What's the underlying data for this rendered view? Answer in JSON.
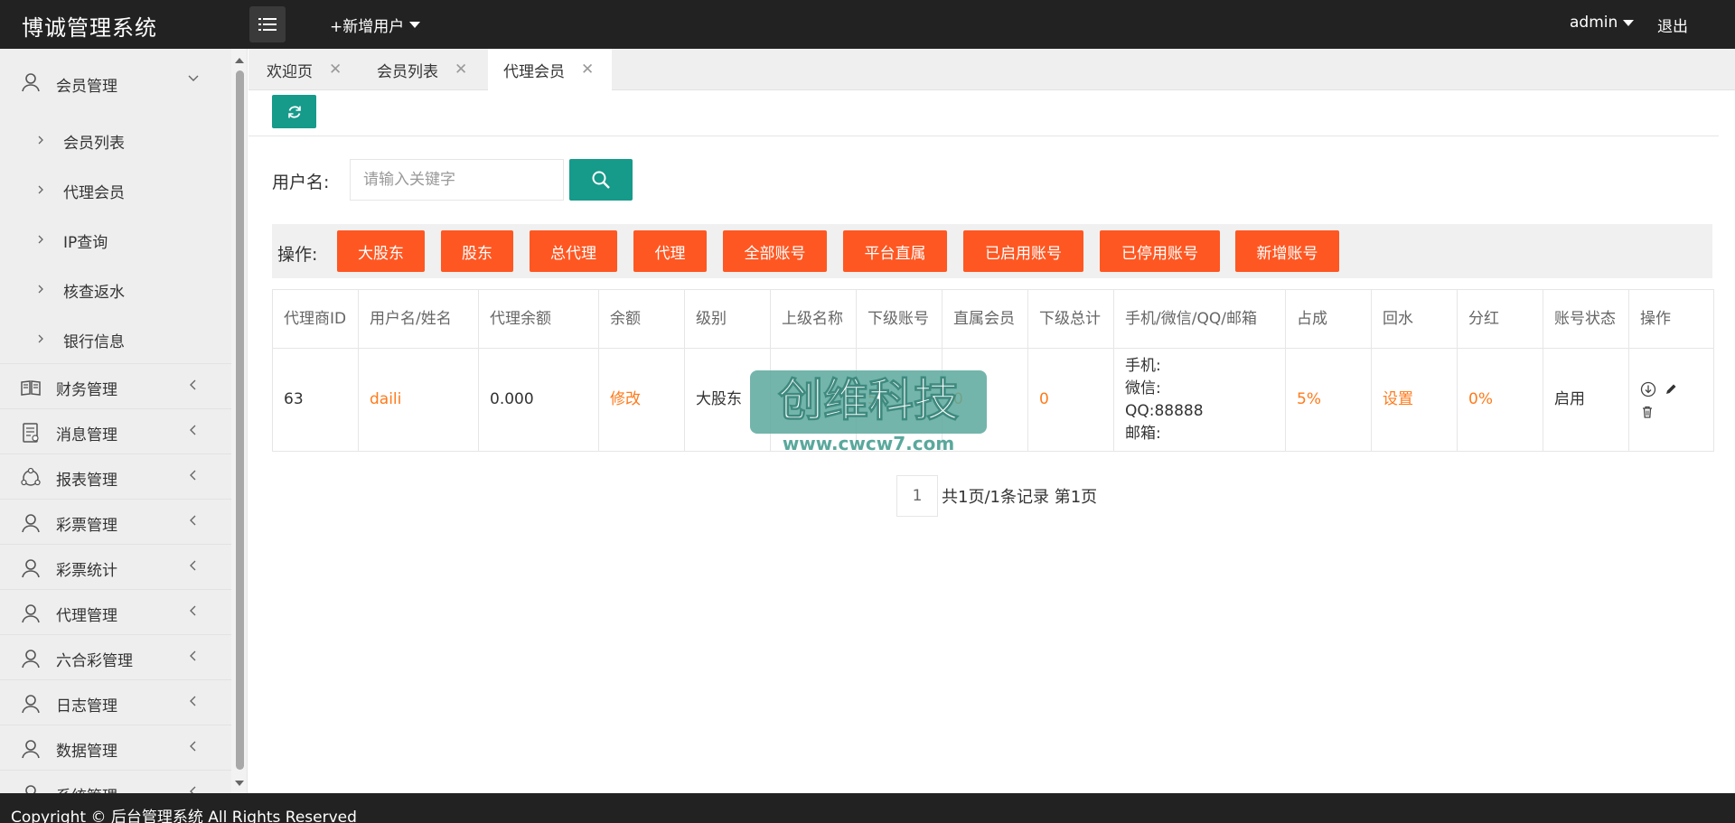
{
  "header": {
    "logo": "博诚管理系统",
    "add_user": "+新增用户",
    "admin": "admin",
    "logout": "退出"
  },
  "sidebar": {
    "groups": [
      {
        "label": "会员管理",
        "icon": "user-icon",
        "expanded": true,
        "items": [
          {
            "label": "会员列表"
          },
          {
            "label": "代理会员"
          },
          {
            "label": "IP查询"
          },
          {
            "label": "核查返水"
          },
          {
            "label": "银行信息"
          }
        ]
      },
      {
        "label": "财务管理",
        "icon": "book-icon"
      },
      {
        "label": "消息管理",
        "icon": "message-icon"
      },
      {
        "label": "报表管理",
        "icon": "report-icon"
      },
      {
        "label": "彩票管理",
        "icon": "user-icon"
      },
      {
        "label": "彩票统计",
        "icon": "user-icon"
      },
      {
        "label": "代理管理",
        "icon": "user-icon"
      },
      {
        "label": "六合彩管理",
        "icon": "user-icon"
      },
      {
        "label": "日志管理",
        "icon": "user-icon"
      },
      {
        "label": "数据管理",
        "icon": "user-icon"
      },
      {
        "label": "系统管理",
        "icon": "user-icon"
      }
    ]
  },
  "tabs": [
    {
      "label": "欢迎页",
      "active": false
    },
    {
      "label": "会员列表",
      "active": false
    },
    {
      "label": "代理会员",
      "active": true
    }
  ],
  "search": {
    "label": "用户名:",
    "placeholder": "请输入关键字"
  },
  "ops": {
    "label": "操作:",
    "buttons": [
      "大股东",
      "股东",
      "总代理",
      "代理",
      "全部账号",
      "平台直属",
      "已启用账号",
      "已停用账号",
      "新增账号"
    ]
  },
  "table": {
    "headers": [
      "代理商ID",
      "用户名/姓名",
      "代理余额",
      "余额",
      "级别",
      "上级名称",
      "下级账号",
      "直属会员",
      "下级总计",
      "手机/微信/QQ/邮箱",
      "占成",
      "回水",
      "分红",
      "账号状态",
      "操作"
    ],
    "rows": [
      {
        "id": "63",
        "username": "daili",
        "agent_balance": "0.000",
        "balance": "修改",
        "level": "大股东",
        "parent": "",
        "sub_accounts": "5",
        "direct_members": "0",
        "sub_total": "0",
        "contact_phone": "手机:",
        "contact_wechat": "微信:",
        "contact_qq": "QQ:88888",
        "contact_email": "邮箱:",
        "share": "5%",
        "rebate": "设置",
        "dividend": "0%",
        "status": "启用"
      }
    ]
  },
  "watermark": {
    "title": "创维科技",
    "url": "www.cwcw7.com"
  },
  "pagination": {
    "current": "1",
    "info": "共1页/1条记录 第1页"
  },
  "footer": {
    "text": "Copyright © 后台管理系统 All Rights Reserved"
  },
  "colors": {
    "header_bg": "#222222",
    "teal": "#169a8a",
    "orange_button": "#ff5722",
    "orange_text": "#ff7a1a"
  }
}
